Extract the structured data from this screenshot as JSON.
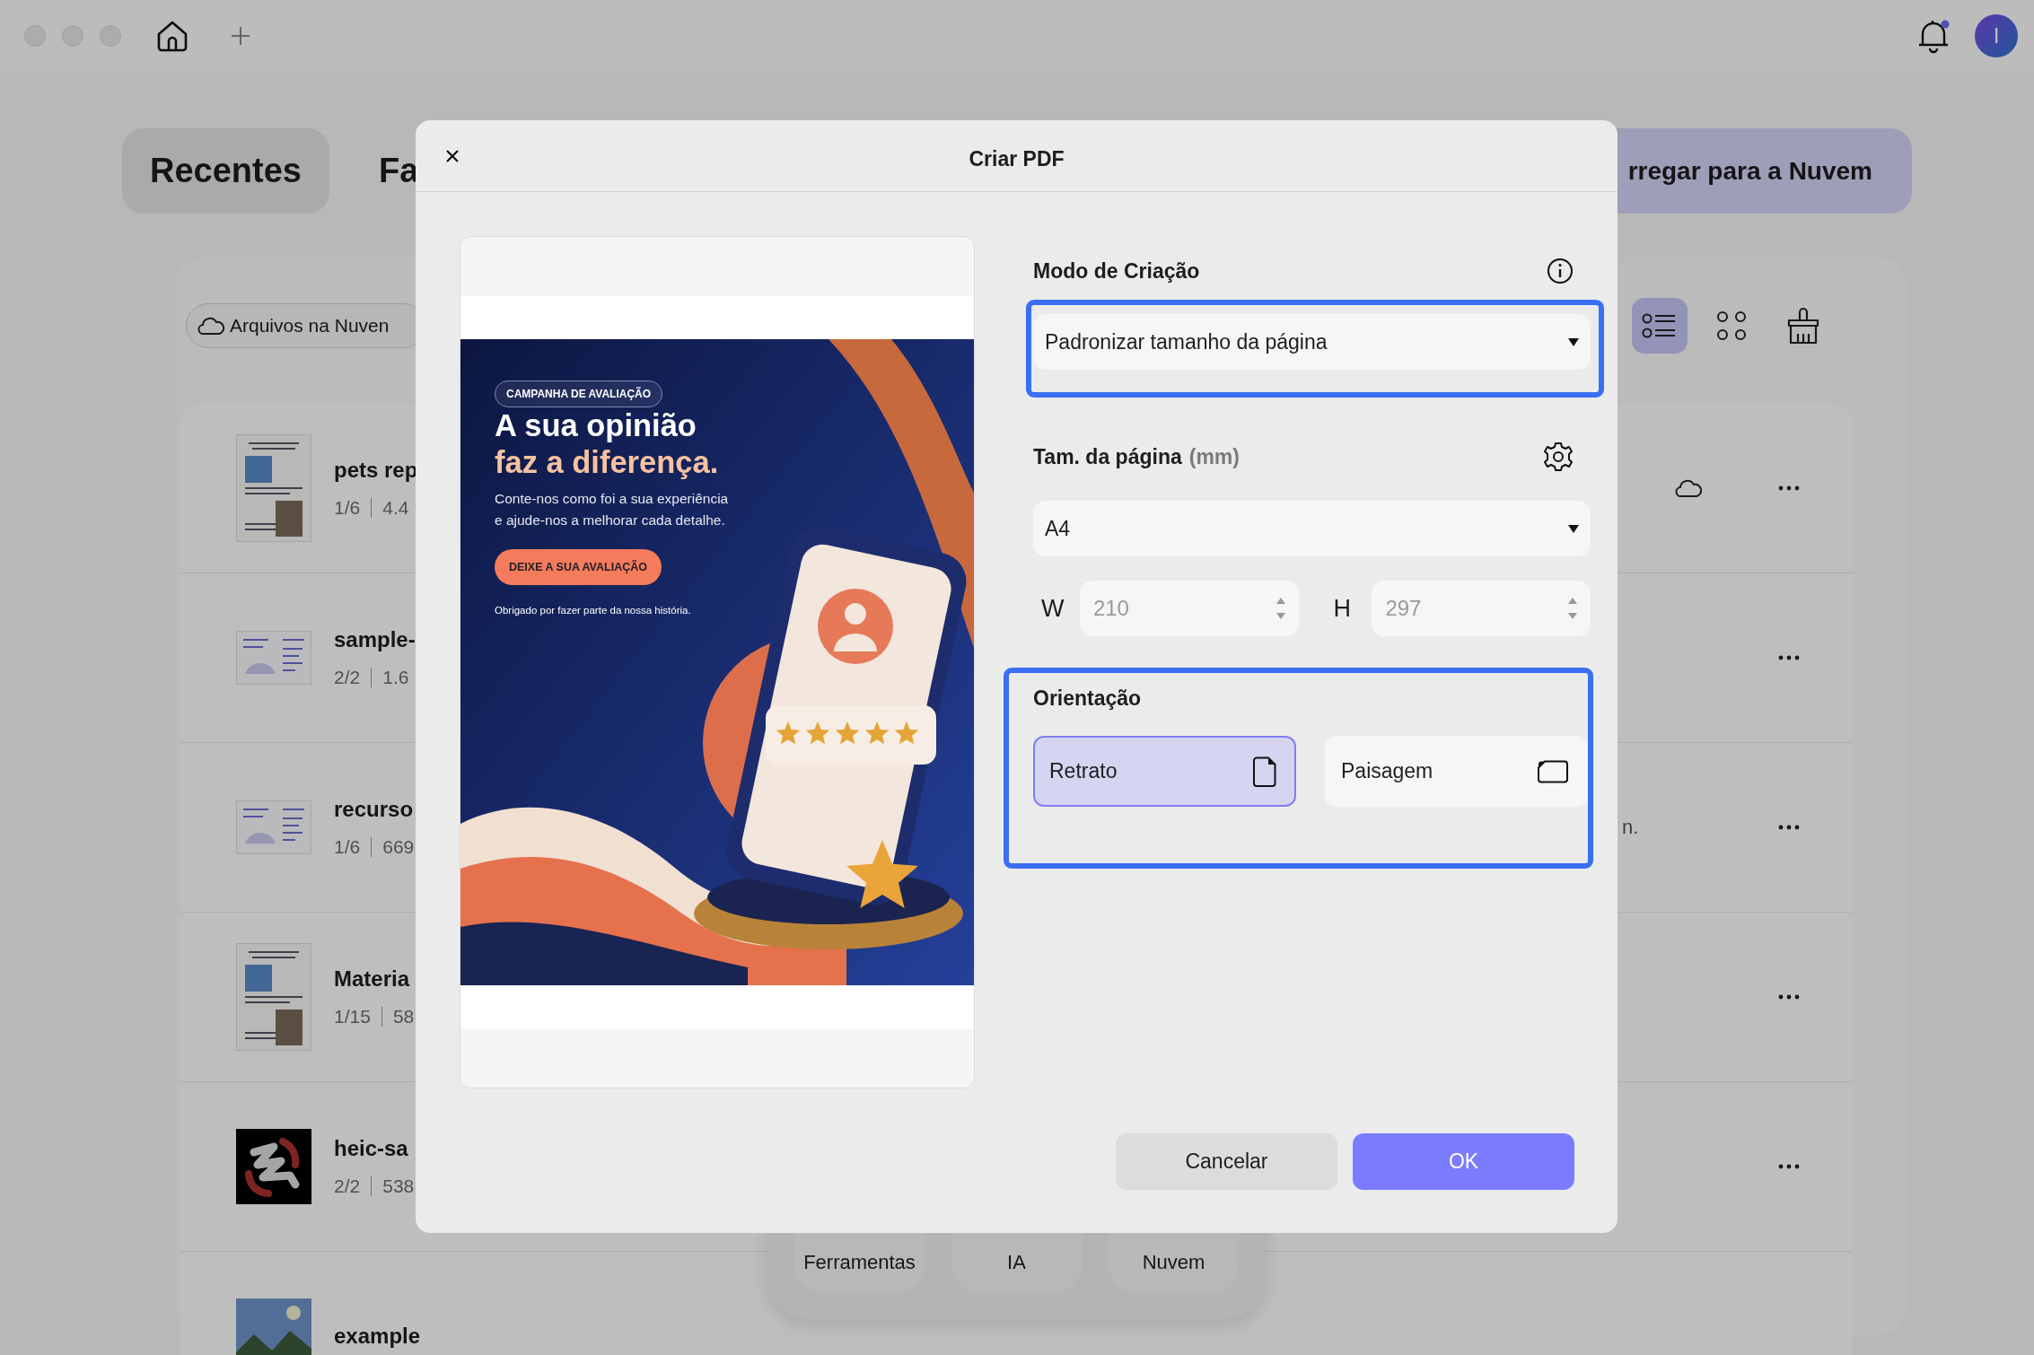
{
  "app": {
    "has_notification": true,
    "avatar": "I",
    "tabs": [
      {
        "label": "Recentes",
        "selected": true
      },
      {
        "label": "Fa",
        "selected": false
      }
    ],
    "upload_button": "rregar para a Nuvem",
    "cloud_filter": "Arquivos na Nuven",
    "view_modes": [
      {
        "kind": "list",
        "selected": true
      },
      {
        "kind": "grid",
        "selected": false
      }
    ],
    "files": [
      {
        "name": "pets rep",
        "pages": "1/6",
        "size": "4.4",
        "kind": "document-portrait",
        "cloud": true
      },
      {
        "name": "sample-",
        "pages": "2/2",
        "size": "1.6",
        "kind": "document-landscape",
        "cloud": false
      },
      {
        "name": "recurso",
        "pages": "1/6",
        "size": "669",
        "kind": "document-landscape",
        "cloud": false,
        "note": "n."
      },
      {
        "name": "Materia",
        "pages": "1/15",
        "size": "58",
        "kind": "document-portrait",
        "cloud": false
      },
      {
        "name": "heic-sa",
        "pages": "2/2",
        "size": "538",
        "kind": "artwork",
        "cloud": false
      },
      {
        "name": "example",
        "cloud": false
      }
    ],
    "dock": [
      "Ferramentas",
      "IA",
      "Nuvem"
    ]
  },
  "dialog": {
    "title": "Criar PDF",
    "preview": {
      "badge": "CAMPANHA DE AVALIAÇÃO",
      "title_lines": [
        "A sua opinião",
        "faz a diferença."
      ],
      "body": "Conte-nos como foi a sua experiência\ne ajude-nos a melhorar cada detalhe.",
      "cta": "DEIXE A SUA AVALIAÇÃO",
      "footer": "Obrigado por fazer parte da nossa história."
    },
    "creation_mode": {
      "label": "Modo de Criação",
      "value": "Padronizar tamanho da página",
      "highlighted": true
    },
    "page_size": {
      "label": "Tam. da página",
      "unit": "(mm)",
      "value": "A4",
      "width": {
        "label": "W",
        "value": "210",
        "disabled": true
      },
      "height": {
        "label": "H",
        "value": "297",
        "disabled": true
      }
    },
    "orientation": {
      "label": "Orientação",
      "highlighted": true,
      "options": [
        {
          "label": "Retrato",
          "kind": "portrait",
          "selected": true
        },
        {
          "label": "Paisagem",
          "kind": "landscape",
          "selected": false
        }
      ]
    },
    "buttons": [
      {
        "label": "Cancelar",
        "kind": "secondary"
      },
      {
        "label": "OK",
        "kind": "primary"
      }
    ]
  }
}
